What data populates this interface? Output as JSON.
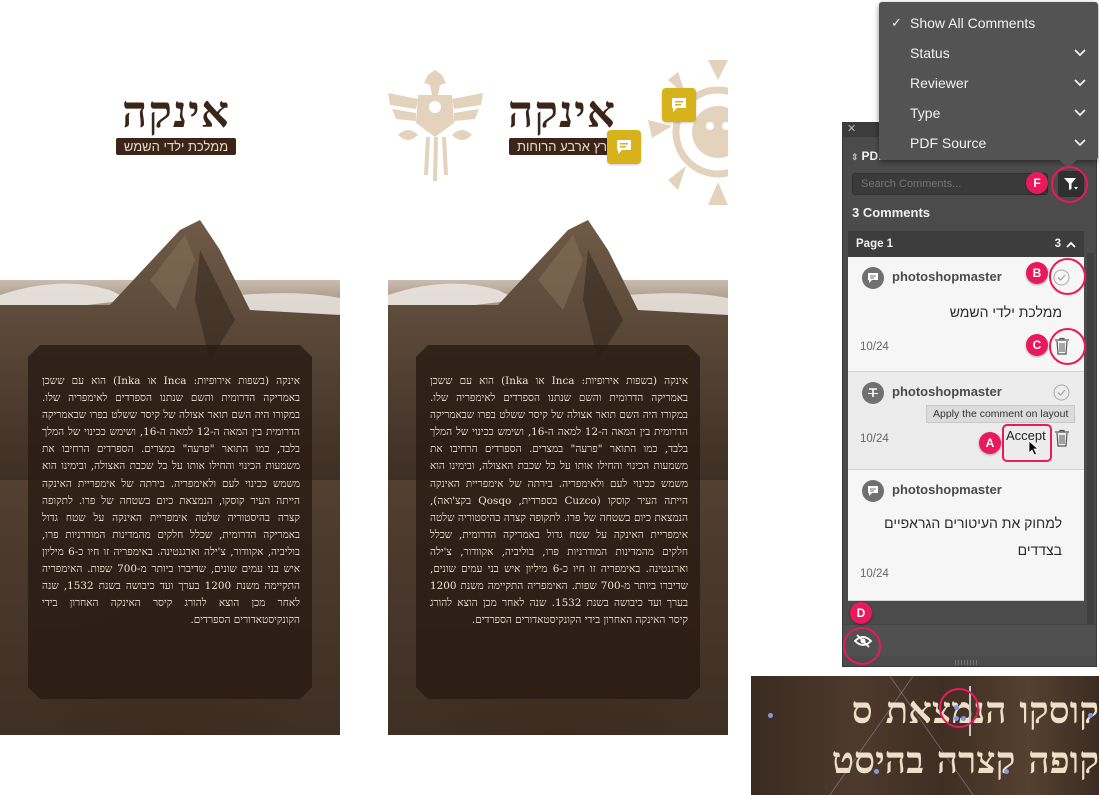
{
  "pages": [
    {
      "id": "left",
      "logo_title": "אינקה",
      "logo_subtitle": "ממלכת ילדי השמש",
      "body_text": "אינקה (בשפות אירופיות: Inca או Inka) הוא עם ששכן באמריקה הדרומית והשם שנתנו הספרדים לאימפריה שלו. במקורו היה השם תואר אצולה של קיסר ששלט בפרו שבאמריקה הדרומית בין המאה ה-12 למאה ה-16, ושימש ככינוי של המלך בלבד, כמו התואר \"פרעה\" במצרים. הספרדים הרחיבו את משמעות הכינוי והחילו אותו על כל שכבת האצולה, ובימינו הוא משמש ככינוי לעם ולאימפריה. בירתה של אימפריית האינקה הייתה העיר קוסקו, הנמצאת כיום בשטחה של פרו. לתקופה קצרה בהיסטוריה שלטה אימפריית האינקה על שטח גדול באמריקה הדרומית, שכלל חלקים מהמדינות המודרניות פרו, בוליביה, אקוודור, צ'ילה וארגנטינה. באימפריה זו חיו כ-6 מיליון איש בני עמים שונים, שדיברו ביותר מ-700 שפות. האימפריה התקיימה משנת 1200 בערך ועד כיבושה בשנת 1532, שנה לאחר מכן הוצא להורג קיסר האינקה האחרון בידי הקונקיסטאדורים הספרדים."
    },
    {
      "id": "right",
      "logo_title": "אינקה",
      "logo_subtitle": "רץ ארבע הרוחות",
      "body_text": "אינקה (בשפות אירופיות: Inca או Inka) הוא עם ששכן באמריקה הדרומית והשם שנתנו הספרדים לאימפריה שלו. במקורו היה השם תואר אצולה של קיסר ששלט בפרו שבאמריקה הדרומית בין המאה ה-12 למאה ה-16, ושימש ככינוי של המלך בלבד, כמו התואר \"פרעה\" במצרים. הספרדים הרחיבו את משמעות הכינוי והחילו אותו על כל שכבת האצולה, ובימינו הוא משמש ככינוי לעם ולאימפריה. בירתה של אימפריית האינקה הייתה העיר קוסקו (Cuzco בספרדית, Qosqo בקצ'ואה), הנמצאת כיום בשטחה של פרו. לתקופה קצרה בהיסטוריה שלטה אימפריית האינקה על שטח גדול באמריקה הדרומית, שכלל חלקים מהמדינות המודרניות פרו, בוליביה, אקוודור, צ'ילה וארגנטינה. באימפריה זו חיו כ-6 מיליון איש בני עמים שונים, שדיברו ביותר מ-700 שפות. האימפריה התקיימה משנת 1200 בערך ועד כיבושה בשנת 1532. שנה לאחר מכן הוצא להורג קיסר האינקה האחרון בידי הקונקיסטאדורים הספרדים."
    }
  ],
  "filter_menu": {
    "items": [
      {
        "label": "Show All Comments",
        "checked": true,
        "has_submenu": false
      },
      {
        "label": "Status",
        "checked": false,
        "has_submenu": true
      },
      {
        "label": "Reviewer",
        "checked": false,
        "has_submenu": true
      },
      {
        "label": "Type",
        "checked": false,
        "has_submenu": true
      },
      {
        "label": "PDF Source",
        "checked": false,
        "has_submenu": true
      }
    ]
  },
  "panel": {
    "tab_label": "PDF Comments",
    "tab_visible_label": "PDI",
    "search_placeholder": "Search Comments...",
    "count_title": "3 Comments",
    "page_group": {
      "label": "Page 1",
      "count": "3"
    },
    "comments": [
      {
        "author": "photoshopmaster",
        "type": "note",
        "text": "ממלכת ילדי השמש",
        "date": "10/24"
      },
      {
        "author": "photoshopmaster",
        "type": "text-edit",
        "text": "",
        "date": "10/24",
        "tooltip": "Apply the comment on layout",
        "accept_label": "Accept"
      },
      {
        "author": "photoshopmaster",
        "type": "note",
        "text": "למחוק את העיטורים הגראפיים בצדדים",
        "date": "10/24"
      }
    ]
  },
  "callouts": {
    "a": "A",
    "b": "B",
    "c": "C",
    "d": "D",
    "f": "F"
  },
  "inset": {
    "line1": "קוסקו הנמצאת ס",
    "line2": "קופה קצרה בהיסט"
  },
  "colors": {
    "accent": "#e8195c",
    "comment_pin": "#d8b21a",
    "panel_bg": "#4b4b4b",
    "menu_bg": "#535353",
    "logo_brown": "#3b2418",
    "text_cream": "#efe4d2"
  }
}
